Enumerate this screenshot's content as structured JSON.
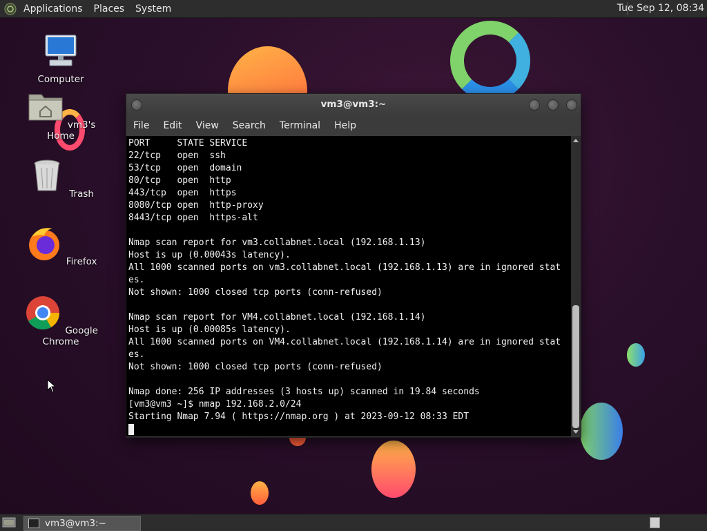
{
  "top_panel": {
    "menus": [
      "Applications",
      "Places",
      "System"
    ],
    "clock": "Tue Sep 12, 08:34"
  },
  "desktop_icons": [
    {
      "label": "Computer",
      "icon": "computer-icon"
    },
    {
      "label": "vm3's Home",
      "icon": "home-folder-icon"
    },
    {
      "label": "Trash",
      "icon": "trash-icon"
    },
    {
      "label": "Firefox",
      "icon": "firefox-icon"
    },
    {
      "label": "Google Chrome",
      "icon": "chrome-icon"
    }
  ],
  "terminal": {
    "title": "vm3@vm3:~",
    "menus": [
      "File",
      "Edit",
      "View",
      "Search",
      "Terminal",
      "Help"
    ],
    "lines": [
      "PORT     STATE SERVICE",
      "22/tcp   open  ssh",
      "53/tcp   open  domain",
      "80/tcp   open  http",
      "443/tcp  open  https",
      "8080/tcp open  http-proxy",
      "8443/tcp open  https-alt",
      "",
      "Nmap scan report for vm3.collabnet.local (192.168.1.13)",
      "Host is up (0.00043s latency).",
      "All 1000 scanned ports on vm3.collabnet.local (192.168.1.13) are in ignored stat",
      "es.",
      "Not shown: 1000 closed tcp ports (conn-refused)",
      "",
      "Nmap scan report for VM4.collabnet.local (192.168.1.14)",
      "Host is up (0.00085s latency).",
      "All 1000 scanned ports on VM4.collabnet.local (192.168.1.14) are in ignored stat",
      "es.",
      "Not shown: 1000 closed tcp ports (conn-refused)",
      "",
      "Nmap done: 256 IP addresses (3 hosts up) scanned in 19.84 seconds",
      "[vm3@vm3 ~]$ nmap 192.168.2.0/24",
      "Starting Nmap 7.94 ( https://nmap.org ) at 2023-09-12 08:33 EDT"
    ]
  },
  "taskbar": {
    "task_label": "vm3@vm3:~"
  }
}
